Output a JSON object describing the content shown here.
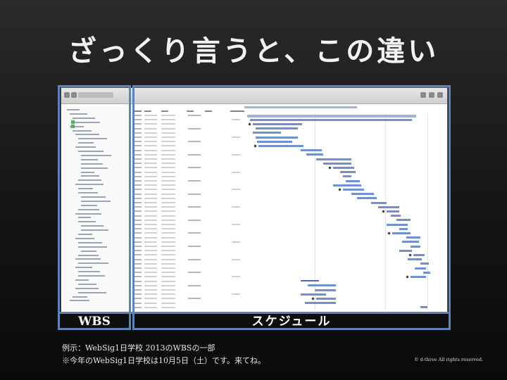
{
  "slide": {
    "title": "ざっくり言うと、この違い",
    "labels": {
      "wbs": "WBS",
      "schedule": "スケジュール"
    },
    "caption_line1": "例示：WebSig1日学校 2013のWBSの一部",
    "caption_line2": "※今年のWebSig1日学校は10月5日（土）です。来てね。",
    "copyright": "© d-three All rights reserved."
  },
  "colors": {
    "frame": "#5b84b8",
    "gantt_bar": "#6f8fcf",
    "task_marker": "#3bbd4c"
  }
}
